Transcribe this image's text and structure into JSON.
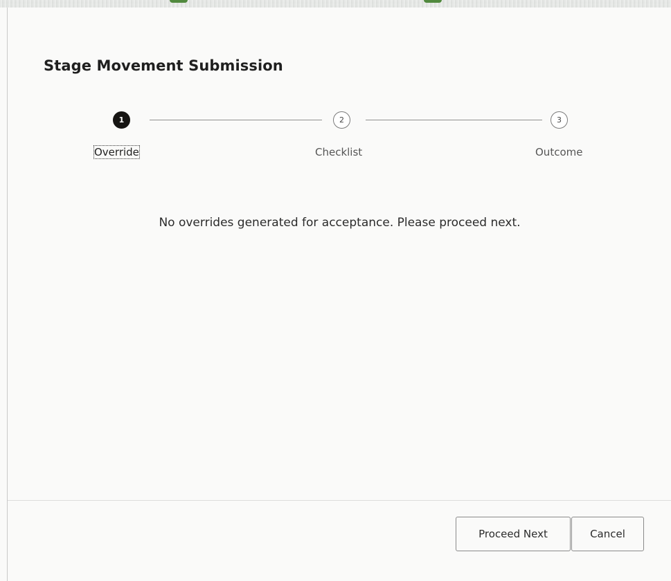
{
  "dialog": {
    "title": "Stage Movement Submission",
    "message": "No overrides generated for acceptance. Please proceed next."
  },
  "train": {
    "steps": [
      {
        "number": "1",
        "label": "Override",
        "state": "active"
      },
      {
        "number": "2",
        "label": "Checklist",
        "state": "idle"
      },
      {
        "number": "3",
        "label": "Outcome",
        "state": "idle"
      }
    ]
  },
  "footer": {
    "proceed_label": "Proceed Next",
    "cancel_label": "Cancel"
  },
  "colors": {
    "active_step": "#161513",
    "background": "#fafaf9",
    "text": "#1f1f1f"
  }
}
